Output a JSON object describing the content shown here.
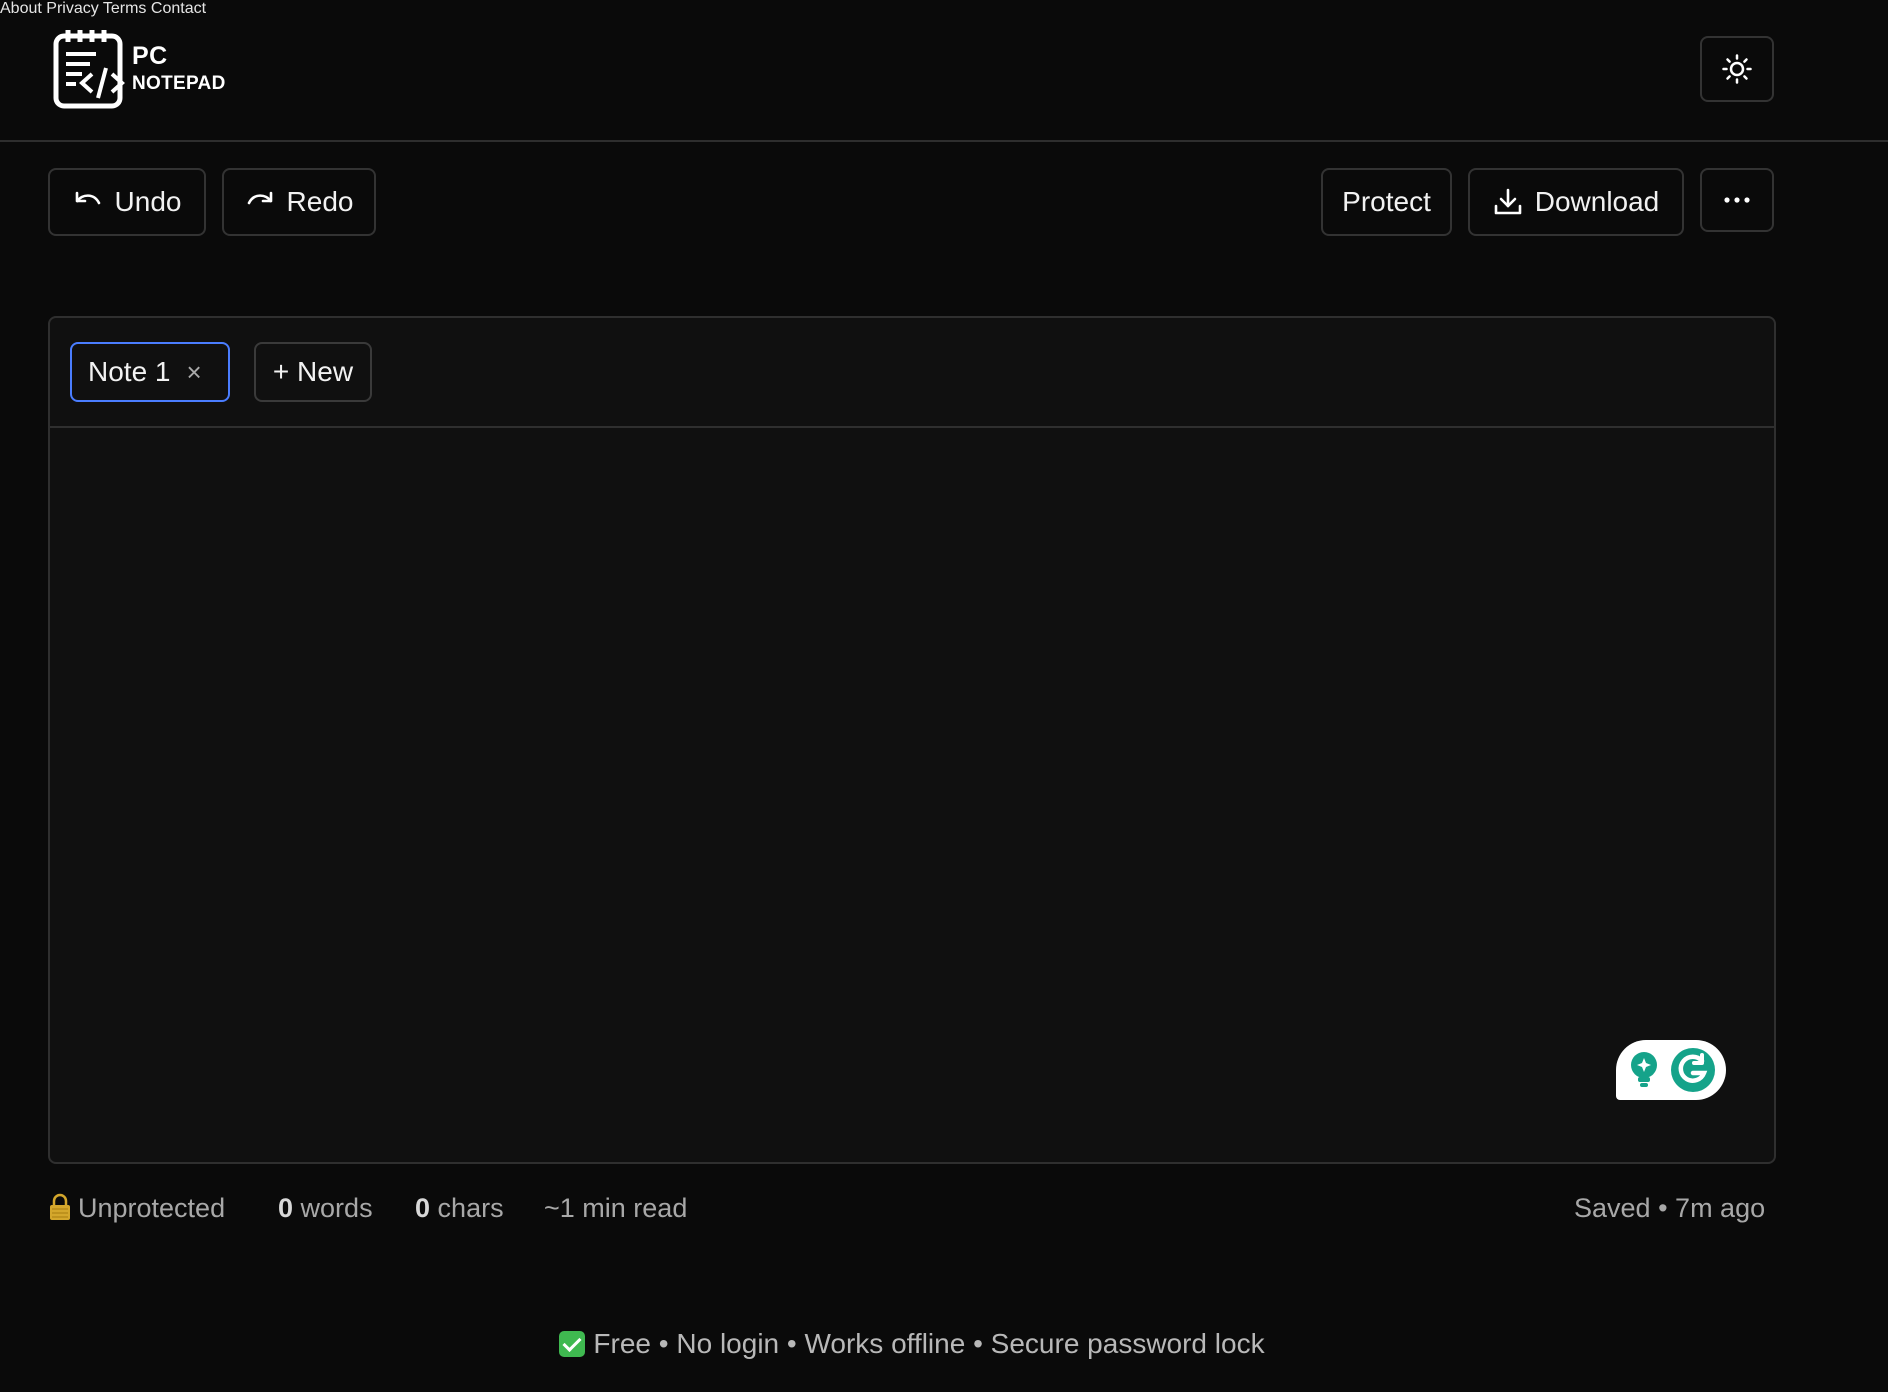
{
  "header": {
    "logo_line1": "PC",
    "logo_line2": "NOTEPAD",
    "nav": [
      "About",
      "Privacy",
      "Terms",
      "Contact"
    ],
    "theme_toggle_icon": "sun-icon"
  },
  "toolbar": {
    "undo_label": "Undo",
    "redo_label": "Redo",
    "protect_label": "Protect",
    "download_label": "Download",
    "more_icon": "more-icon"
  },
  "tabs": {
    "items": [
      {
        "label": "Note 1",
        "close": "×",
        "active": true
      }
    ],
    "new_label": "+ New"
  },
  "editor": {
    "value": ""
  },
  "status": {
    "lock_state": "Unprotected",
    "word_count": "0",
    "word_label": "words",
    "char_count": "0",
    "char_label": "chars",
    "read_time": "~1 min read",
    "saved_label": "Saved",
    "saved_time": "7m ago"
  },
  "footer": {
    "items": [
      "Free",
      "No login",
      "Works offline",
      "Secure password lock"
    ]
  },
  "colors": {
    "background": "#0a0a0a",
    "card": "#101010",
    "active_tab_border": "#4a7dff",
    "grammarly_green": "#15a38a",
    "check_green": "#3fb950"
  }
}
